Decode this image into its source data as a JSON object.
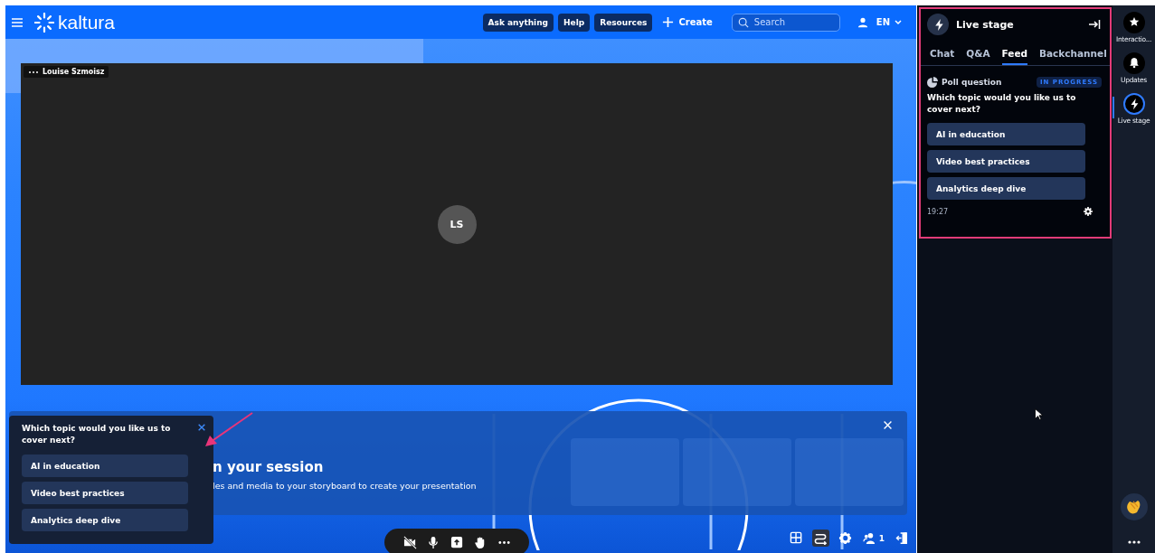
{
  "header": {
    "logo": "kaltura",
    "buttons": [
      "Ask anything",
      "Help",
      "Resources"
    ],
    "create": "Create",
    "search": {
      "placeholder": "Search"
    },
    "language": "EN"
  },
  "video": {
    "participant": "Louise Szmoisz",
    "initials": "LS"
  },
  "storyboard_banner": {
    "title": "n your session",
    "subtitle": "les and media to your storyboard to create your presentation"
  },
  "poll_popup": {
    "question": "Which topic would you like us to cover next?",
    "options": [
      "AI in education",
      "Video best practices",
      "Analytics deep dive"
    ]
  },
  "controls": [
    {
      "kind": "camera"
    },
    {
      "kind": "mic"
    },
    {
      "kind": "share"
    },
    {
      "kind": "hand"
    },
    {
      "kind": "more"
    }
  ],
  "tools": [
    {
      "kind": "grid",
      "selected": false
    },
    {
      "kind": "flow",
      "selected": true
    },
    {
      "kind": "settings",
      "selected": false
    },
    {
      "kind": "people",
      "selected": false,
      "count": "1"
    },
    {
      "kind": "leave",
      "selected": false
    }
  ],
  "live_stage": {
    "title": "Live stage",
    "tabs": [
      {
        "label": "Chat",
        "selected": false
      },
      {
        "label": "Q&A",
        "selected": false
      },
      {
        "label": "Feed",
        "selected": true
      },
      {
        "label": "Backchannel",
        "selected": false
      }
    ],
    "poll": {
      "label": "Poll question",
      "status": "IN PROGRESS",
      "question": "Which topic would you like us to cover next?",
      "options": [
        "AI in education",
        "Video best practices",
        "Analytics deep dive"
      ],
      "time": "19:27"
    }
  },
  "rail": [
    {
      "kind": "star",
      "label": "Interactio...",
      "selected": false
    },
    {
      "kind": "bell",
      "label": "Updates",
      "selected": false
    },
    {
      "kind": "bolt",
      "label": "Live stage",
      "selected": true
    }
  ]
}
